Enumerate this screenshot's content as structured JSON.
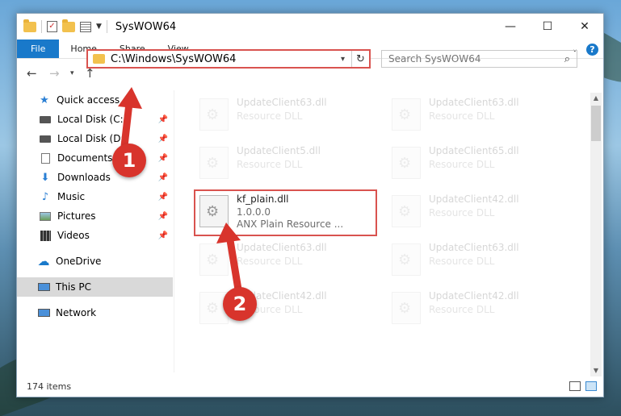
{
  "window": {
    "title": "SysWOW64",
    "controls": {
      "minimize": "—",
      "maximize": "☐",
      "close": "✕"
    }
  },
  "ribbon": {
    "tabs": [
      "File",
      "Home",
      "Share",
      "View"
    ],
    "help": "?"
  },
  "address": {
    "path": "C:\\Windows\\SysWOW64"
  },
  "search": {
    "placeholder": "Search SysWOW64"
  },
  "sidebar": {
    "items": [
      {
        "label": "Quick access",
        "icon": "star-icon",
        "pinned": false
      },
      {
        "label": "Local Disk (C:)",
        "icon": "drive-icon",
        "pinned": true
      },
      {
        "label": "Local Disk (D:)",
        "icon": "drive-icon",
        "pinned": true
      },
      {
        "label": "Documents",
        "icon": "documents-icon",
        "pinned": true
      },
      {
        "label": "Downloads",
        "icon": "downloads-icon",
        "pinned": true
      },
      {
        "label": "Music",
        "icon": "music-icon",
        "pinned": true
      },
      {
        "label": "Pictures",
        "icon": "pictures-icon",
        "pinned": true
      },
      {
        "label": "Videos",
        "icon": "videos-icon",
        "pinned": true
      },
      {
        "label": "OneDrive",
        "icon": "onedrive-icon",
        "pinned": false
      },
      {
        "label": "This PC",
        "icon": "pc-icon",
        "pinned": false,
        "selected": true
      },
      {
        "label": "Network",
        "icon": "network-icon",
        "pinned": false
      }
    ]
  },
  "files": {
    "left": [
      {
        "name": "UpdateClient63.dll",
        "sub": "Resource DLL",
        "faded": true
      },
      {
        "name": "UpdateClient5.dll",
        "sub": "Resource DLL",
        "faded": true
      },
      {
        "name": "kf_plain.dll",
        "sub": "1.0.0.0",
        "sub2": "ANX Plain Resource ...",
        "faded": false
      },
      {
        "name": "UpdateClient63.dll",
        "sub": "Resource DLL",
        "faded": true
      },
      {
        "name": "UpdateClient42.dll",
        "sub": "Resource DLL",
        "faded": true
      }
    ],
    "right": [
      {
        "name": "UpdateClient63.dll",
        "sub": "Resource DLL",
        "faded": true
      },
      {
        "name": "UpdateClient65.dll",
        "sub": "Resource DLL",
        "faded": true
      },
      {
        "name": "UpdateClient42.dll",
        "sub": "Resource DLL",
        "faded": true
      },
      {
        "name": "UpdateClient63.dll",
        "sub": "Resource DLL",
        "faded": true
      },
      {
        "name": "UpdateClient42.dll",
        "sub": "Resource DLL",
        "faded": true
      }
    ]
  },
  "status": {
    "count": "174 items"
  },
  "callouts": {
    "one": "1",
    "two": "2"
  },
  "colors": {
    "accent": "#1979ca",
    "highlight": "#d9534f",
    "badge": "#d8342c"
  }
}
